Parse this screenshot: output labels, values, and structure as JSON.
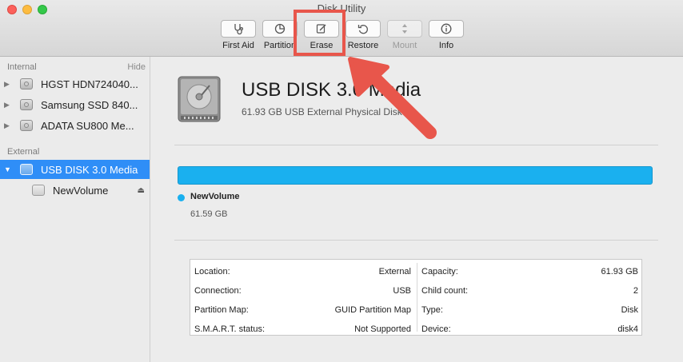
{
  "window": {
    "title": "Disk Utility"
  },
  "toolbar": {
    "buttons": [
      {
        "label": "First Aid",
        "icon": "stethoscope-icon",
        "enabled": true
      },
      {
        "label": "Partition",
        "icon": "pie-icon",
        "enabled": true
      },
      {
        "label": "Erase",
        "icon": "erase-icon",
        "enabled": true
      },
      {
        "label": "Restore",
        "icon": "restore-icon",
        "enabled": true
      },
      {
        "label": "Mount",
        "icon": "mount-icon",
        "enabled": false
      },
      {
        "label": "Info",
        "icon": "info-icon",
        "enabled": true
      }
    ]
  },
  "sidebar": {
    "internal_title": "Internal",
    "hide_label": "Hide",
    "internal_items": [
      {
        "label": "HGST HDN724040..."
      },
      {
        "label": "Samsung SSD 840..."
      },
      {
        "label": "ADATA SU800 Me..."
      }
    ],
    "external_title": "External",
    "external_items": [
      {
        "label": "USB DISK 3.0 Media",
        "selected": true
      },
      {
        "label": "NewVolume",
        "eject": "⏏"
      }
    ]
  },
  "main": {
    "drive_name": "USB DISK 3.0 Media",
    "drive_subtitle": "61.93 GB USB External Physical Disk",
    "usage": {
      "fraction_used": 1.0,
      "color": "#1ab0ef"
    },
    "legend": {
      "name": "NewVolume",
      "size": "61.59 GB"
    },
    "info_left": [
      {
        "key": "Location:",
        "value": "External"
      },
      {
        "key": "Connection:",
        "value": "USB"
      },
      {
        "key": "Partition Map:",
        "value": "GUID Partition Map"
      },
      {
        "key": "S.M.A.R.T. status:",
        "value": "Not Supported"
      }
    ],
    "info_right": [
      {
        "key": "Capacity:",
        "value": "61.93 GB"
      },
      {
        "key": "Child count:",
        "value": "2"
      },
      {
        "key": "Type:",
        "value": "Disk"
      },
      {
        "key": "Device:",
        "value": "disk4"
      }
    ]
  },
  "colors": {
    "accent": "#2f8ef7",
    "highlight": "#e8564b",
    "bar": "#1ab0ef"
  }
}
